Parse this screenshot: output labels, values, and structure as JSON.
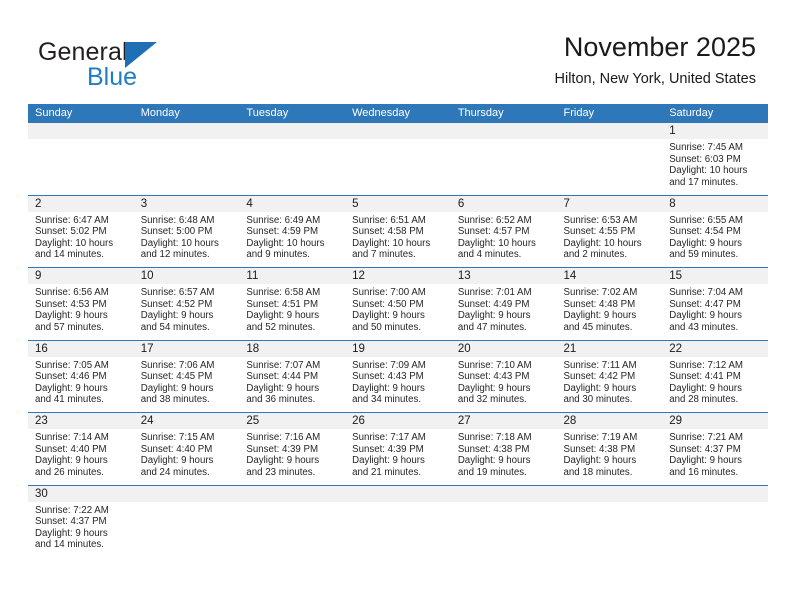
{
  "brand": {
    "name_top": "General",
    "name_bottom": "Blue",
    "triangle_color": "#1f6fb7",
    "blue_color": "#1f7dc4"
  },
  "header": {
    "title": "November 2025",
    "location": "Hilton, New York, United States"
  },
  "theme": {
    "header_blue": "#2e78ba",
    "daynum_band": "#f1f1f1",
    "separator": "#2e78ba"
  },
  "calendar": {
    "weekday_headers": [
      "Sunday",
      "Monday",
      "Tuesday",
      "Wednesday",
      "Thursday",
      "Friday",
      "Saturday"
    ],
    "weeks": [
      [
        {
          "day": "",
          "lines": [
            "",
            "",
            "",
            ""
          ]
        },
        {
          "day": "",
          "lines": [
            "",
            "",
            "",
            ""
          ]
        },
        {
          "day": "",
          "lines": [
            "",
            "",
            "",
            ""
          ]
        },
        {
          "day": "",
          "lines": [
            "",
            "",
            "",
            ""
          ]
        },
        {
          "day": "",
          "lines": [
            "",
            "",
            "",
            ""
          ]
        },
        {
          "day": "",
          "lines": [
            "",
            "",
            "",
            ""
          ]
        },
        {
          "day": "1",
          "lines": [
            "Sunrise: 7:45 AM",
            "Sunset: 6:03 PM",
            "Daylight: 10 hours",
            "and 17 minutes."
          ]
        }
      ],
      [
        {
          "day": "2",
          "lines": [
            "Sunrise: 6:47 AM",
            "Sunset: 5:02 PM",
            "Daylight: 10 hours",
            "and 14 minutes."
          ]
        },
        {
          "day": "3",
          "lines": [
            "Sunrise: 6:48 AM",
            "Sunset: 5:00 PM",
            "Daylight: 10 hours",
            "and 12 minutes."
          ]
        },
        {
          "day": "4",
          "lines": [
            "Sunrise: 6:49 AM",
            "Sunset: 4:59 PM",
            "Daylight: 10 hours",
            "and 9 minutes."
          ]
        },
        {
          "day": "5",
          "lines": [
            "Sunrise: 6:51 AM",
            "Sunset: 4:58 PM",
            "Daylight: 10 hours",
            "and 7 minutes."
          ]
        },
        {
          "day": "6",
          "lines": [
            "Sunrise: 6:52 AM",
            "Sunset: 4:57 PM",
            "Daylight: 10 hours",
            "and 4 minutes."
          ]
        },
        {
          "day": "7",
          "lines": [
            "Sunrise: 6:53 AM",
            "Sunset: 4:55 PM",
            "Daylight: 10 hours",
            "and 2 minutes."
          ]
        },
        {
          "day": "8",
          "lines": [
            "Sunrise: 6:55 AM",
            "Sunset: 4:54 PM",
            "Daylight: 9 hours",
            "and 59 minutes."
          ]
        }
      ],
      [
        {
          "day": "9",
          "lines": [
            "Sunrise: 6:56 AM",
            "Sunset: 4:53 PM",
            "Daylight: 9 hours",
            "and 57 minutes."
          ]
        },
        {
          "day": "10",
          "lines": [
            "Sunrise: 6:57 AM",
            "Sunset: 4:52 PM",
            "Daylight: 9 hours",
            "and 54 minutes."
          ]
        },
        {
          "day": "11",
          "lines": [
            "Sunrise: 6:58 AM",
            "Sunset: 4:51 PM",
            "Daylight: 9 hours",
            "and 52 minutes."
          ]
        },
        {
          "day": "12",
          "lines": [
            "Sunrise: 7:00 AM",
            "Sunset: 4:50 PM",
            "Daylight: 9 hours",
            "and 50 minutes."
          ]
        },
        {
          "day": "13",
          "lines": [
            "Sunrise: 7:01 AM",
            "Sunset: 4:49 PM",
            "Daylight: 9 hours",
            "and 47 minutes."
          ]
        },
        {
          "day": "14",
          "lines": [
            "Sunrise: 7:02 AM",
            "Sunset: 4:48 PM",
            "Daylight: 9 hours",
            "and 45 minutes."
          ]
        },
        {
          "day": "15",
          "lines": [
            "Sunrise: 7:04 AM",
            "Sunset: 4:47 PM",
            "Daylight: 9 hours",
            "and 43 minutes."
          ]
        }
      ],
      [
        {
          "day": "16",
          "lines": [
            "Sunrise: 7:05 AM",
            "Sunset: 4:46 PM",
            "Daylight: 9 hours",
            "and 41 minutes."
          ]
        },
        {
          "day": "17",
          "lines": [
            "Sunrise: 7:06 AM",
            "Sunset: 4:45 PM",
            "Daylight: 9 hours",
            "and 38 minutes."
          ]
        },
        {
          "day": "18",
          "lines": [
            "Sunrise: 7:07 AM",
            "Sunset: 4:44 PM",
            "Daylight: 9 hours",
            "and 36 minutes."
          ]
        },
        {
          "day": "19",
          "lines": [
            "Sunrise: 7:09 AM",
            "Sunset: 4:43 PM",
            "Daylight: 9 hours",
            "and 34 minutes."
          ]
        },
        {
          "day": "20",
          "lines": [
            "Sunrise: 7:10 AM",
            "Sunset: 4:43 PM",
            "Daylight: 9 hours",
            "and 32 minutes."
          ]
        },
        {
          "day": "21",
          "lines": [
            "Sunrise: 7:11 AM",
            "Sunset: 4:42 PM",
            "Daylight: 9 hours",
            "and 30 minutes."
          ]
        },
        {
          "day": "22",
          "lines": [
            "Sunrise: 7:12 AM",
            "Sunset: 4:41 PM",
            "Daylight: 9 hours",
            "and 28 minutes."
          ]
        }
      ],
      [
        {
          "day": "23",
          "lines": [
            "Sunrise: 7:14 AM",
            "Sunset: 4:40 PM",
            "Daylight: 9 hours",
            "and 26 minutes."
          ]
        },
        {
          "day": "24",
          "lines": [
            "Sunrise: 7:15 AM",
            "Sunset: 4:40 PM",
            "Daylight: 9 hours",
            "and 24 minutes."
          ]
        },
        {
          "day": "25",
          "lines": [
            "Sunrise: 7:16 AM",
            "Sunset: 4:39 PM",
            "Daylight: 9 hours",
            "and 23 minutes."
          ]
        },
        {
          "day": "26",
          "lines": [
            "Sunrise: 7:17 AM",
            "Sunset: 4:39 PM",
            "Daylight: 9 hours",
            "and 21 minutes."
          ]
        },
        {
          "day": "27",
          "lines": [
            "Sunrise: 7:18 AM",
            "Sunset: 4:38 PM",
            "Daylight: 9 hours",
            "and 19 minutes."
          ]
        },
        {
          "day": "28",
          "lines": [
            "Sunrise: 7:19 AM",
            "Sunset: 4:38 PM",
            "Daylight: 9 hours",
            "and 18 minutes."
          ]
        },
        {
          "day": "29",
          "lines": [
            "Sunrise: 7:21 AM",
            "Sunset: 4:37 PM",
            "Daylight: 9 hours",
            "and 16 minutes."
          ]
        }
      ],
      [
        {
          "day": "30",
          "lines": [
            "Sunrise: 7:22 AM",
            "Sunset: 4:37 PM",
            "Daylight: 9 hours",
            "and 14 minutes."
          ]
        },
        {
          "day": "",
          "lines": [
            "",
            "",
            "",
            ""
          ]
        },
        {
          "day": "",
          "lines": [
            "",
            "",
            "",
            ""
          ]
        },
        {
          "day": "",
          "lines": [
            "",
            "",
            "",
            ""
          ]
        },
        {
          "day": "",
          "lines": [
            "",
            "",
            "",
            ""
          ]
        },
        {
          "day": "",
          "lines": [
            "",
            "",
            "",
            ""
          ]
        },
        {
          "day": "",
          "lines": [
            "",
            "",
            "",
            ""
          ]
        }
      ]
    ]
  }
}
